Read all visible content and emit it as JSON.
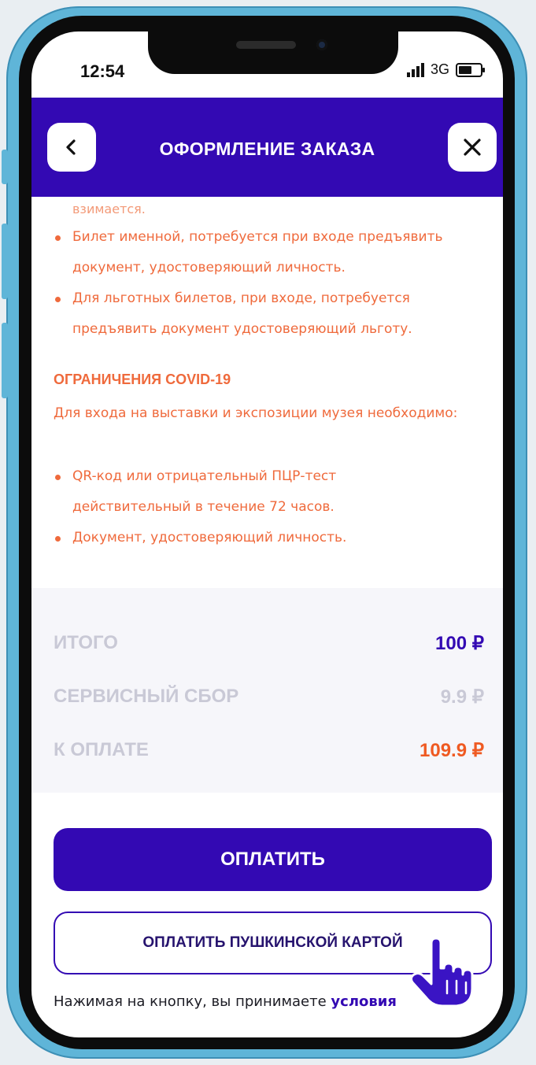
{
  "status_bar": {
    "time": "12:54",
    "network": "3G"
  },
  "header": {
    "title": "ОФОРМЛЕНИЕ ЗАКАЗА",
    "back_icon": "chevron-left-icon",
    "close_icon": "close-icon"
  },
  "info": {
    "partial_line": "взимается.",
    "bullets": [
      {
        "line1": "Билет именной, потребуется при входе предъявить",
        "line2": "документ, удостоверяющий личность."
      },
      {
        "line1": "Для льготных билетов, при входе, потребуется",
        "line2": "предъявить документ удостоверяющий льготу."
      }
    ],
    "covid_title": "ОГРАНИЧЕНИЯ COVID-19",
    "covid_text": "Для входа на выставки и экспозиции музея необходимо:",
    "covid_bullets": [
      {
        "line1": "QR-код или отрицательный ПЦР-тест",
        "line2": "действительный в течение 72 часов."
      },
      {
        "line1": "Документ, удостоверяющий личность.",
        "line2": ""
      }
    ]
  },
  "totals": {
    "rows": [
      {
        "label": "ИТОГО",
        "value": "100 ₽"
      },
      {
        "label": "СЕРВИСНЫЙ СБОР",
        "value": "9.9 ₽"
      },
      {
        "label": "К ОПЛАТЕ",
        "value": "109.9 ₽"
      }
    ]
  },
  "actions": {
    "pay_label": "ОПЛАТИТЬ",
    "pushkin_label": "ОПЛАТИТЬ ПУШКИНСКОЙ КАРТОЙ",
    "consent_text": "Нажимая на кнопку, вы принимаете ",
    "consent_link": "условия"
  },
  "colors": {
    "brand": "#3309b3",
    "accent": "#ef6a3c",
    "muted": "#c9c9d6"
  }
}
